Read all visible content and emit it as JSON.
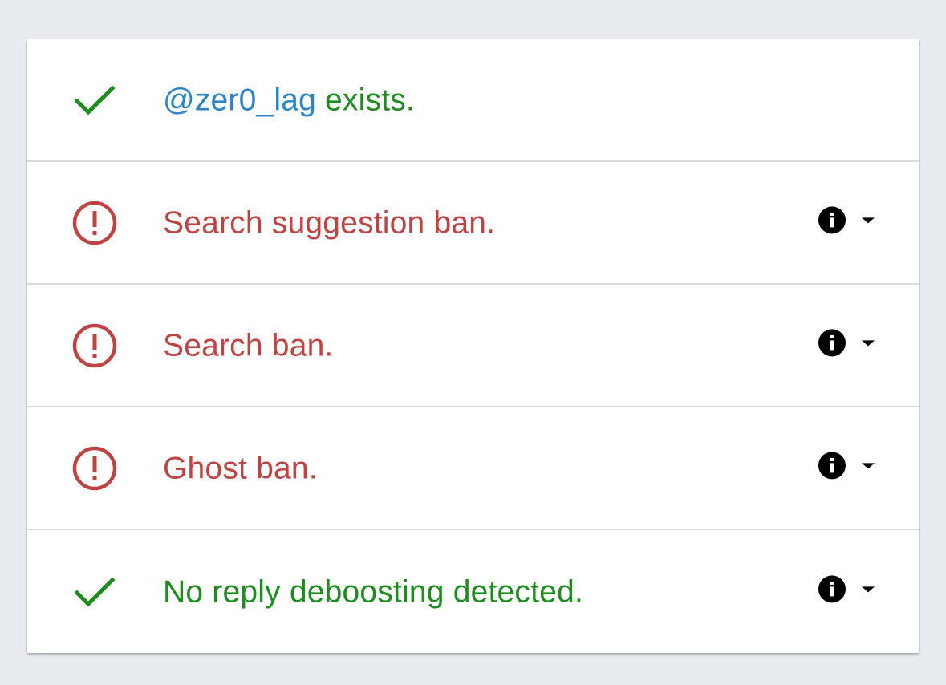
{
  "colors": {
    "page_background": "#e8ecf1",
    "card_background": "#ffffff",
    "fail": "#c04343",
    "ok": "#1e8c1e",
    "handle": "#2a84c6",
    "divider": "#dcdcdc"
  },
  "results": [
    {
      "status": "ok",
      "icon": "check-icon",
      "handle": "@zer0_lag",
      "text": " exists.",
      "has_controls": false
    },
    {
      "status": "fail",
      "icon": "alert-circle-icon",
      "text": "Search suggestion ban.",
      "has_controls": true,
      "info_icon": "info-icon",
      "expand_icon": "caret-down-icon"
    },
    {
      "status": "fail",
      "icon": "alert-circle-icon",
      "text": "Search ban.",
      "has_controls": true,
      "info_icon": "info-icon",
      "expand_icon": "caret-down-icon"
    },
    {
      "status": "fail",
      "icon": "alert-circle-icon",
      "text": "Ghost ban.",
      "has_controls": true,
      "info_icon": "info-icon",
      "expand_icon": "caret-down-icon"
    },
    {
      "status": "ok",
      "icon": "check-icon",
      "text": "No reply deboosting detected.",
      "has_controls": true,
      "info_icon": "info-icon",
      "expand_icon": "caret-down-icon"
    }
  ]
}
